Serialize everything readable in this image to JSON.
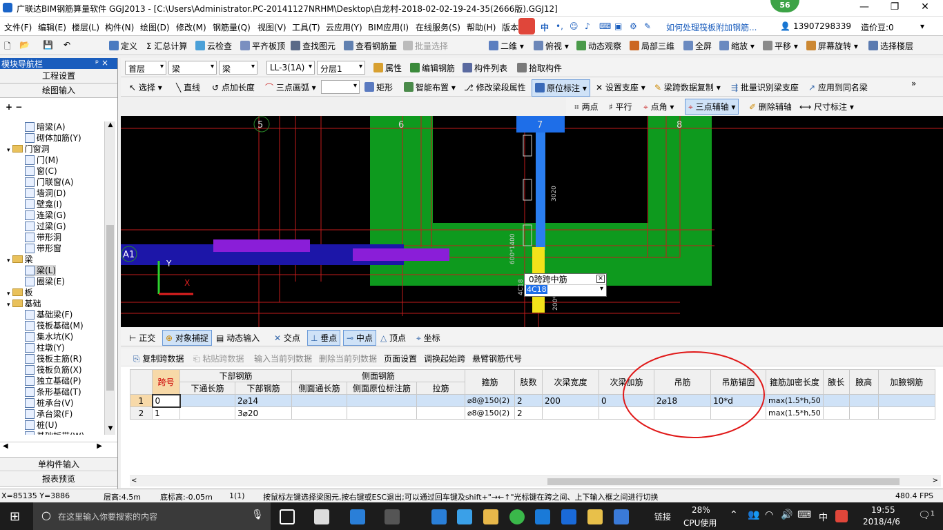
{
  "window": {
    "title": "广联达BIM钢筋算量软件 GGJ2013 - [C:\\Users\\Administrator.PC-20141127NRHM\\Desktop\\白龙村-2018-02-02-19-24-35(2666版).GGJ12]",
    "badge": "56",
    "minimize": "—",
    "restore": "❐",
    "close": "✕"
  },
  "menu": [
    "文件(F)",
    "编辑(E)",
    "楼层(L)",
    "构件(N)",
    "绘图(D)",
    "修改(M)",
    "钢筋量(Q)",
    "视图(V)",
    "工具(T)",
    "云应用(Y)",
    "BIM应用(I)",
    "在线服务(S)",
    "帮助(H)",
    "版本"
  ],
  "menu_right": {
    "ime": "中",
    "link": "如何处理筏板附加钢筋...",
    "phone": "13907298339",
    "price": "造价豆:0"
  },
  "toolbar1": [
    "定义",
    "Σ 汇总计算",
    "云检查",
    "平齐板顶",
    "查找图元",
    "查看钢筋量",
    "批量选择",
    "二维",
    "俯视",
    "动态观察",
    "局部三维",
    "全屏",
    "缩放",
    "平移",
    "屏幕旋转",
    "选择楼层"
  ],
  "toolbar2": {
    "floor": "首层",
    "type1": "梁",
    "type2": "梁",
    "member": "LL-3(1A)",
    "layer": "分层1",
    "buttons": [
      "属性",
      "编辑钢筋",
      "构件列表",
      "拾取构件"
    ]
  },
  "toolbar3": [
    "选择",
    "直线",
    "点加长度",
    "三点画弧",
    "矩形",
    "智能布置",
    "修改梁段属性",
    "原位标注",
    "设置支座",
    "梁跨数据复制",
    "批量识别梁支座",
    "应用到同名梁"
  ],
  "toolbar4": [
    "两点",
    "平行",
    "点角",
    "三点辅轴",
    "删除辅轴",
    "尺寸标注"
  ],
  "leftpanel": {
    "title": "模块导航栏",
    "pin": "ᵖ ×",
    "btn1": "工程设置",
    "btn2": "绘图输入",
    "bottom1": "单构件输入",
    "bottom2": "报表预览",
    "tree": [
      {
        "label": "暗梁(A)",
        "level": 2
      },
      {
        "label": "砌体加筋(Y)",
        "level": 2
      },
      {
        "label": "门窗洞",
        "level": 1,
        "folder": true
      },
      {
        "label": "门(M)",
        "level": 2
      },
      {
        "label": "窗(C)",
        "level": 2
      },
      {
        "label": "门联窗(A)",
        "level": 2
      },
      {
        "label": "墙洞(D)",
        "level": 2
      },
      {
        "label": "壁龛(I)",
        "level": 2
      },
      {
        "label": "连梁(G)",
        "level": 2
      },
      {
        "label": "过梁(G)",
        "level": 2
      },
      {
        "label": "带形洞",
        "level": 2
      },
      {
        "label": "带形窗",
        "level": 2
      },
      {
        "label": "梁",
        "level": 1,
        "folder": true
      },
      {
        "label": "梁(L)",
        "level": 2,
        "selected": true
      },
      {
        "label": "圈梁(E)",
        "level": 2
      },
      {
        "label": "板",
        "level": 1,
        "folder": true
      },
      {
        "label": "基础",
        "level": 1,
        "folder": true
      },
      {
        "label": "基础梁(F)",
        "level": 2
      },
      {
        "label": "筏板基础(M)",
        "level": 2
      },
      {
        "label": "集水坑(K)",
        "level": 2
      },
      {
        "label": "柱墩(Y)",
        "level": 2
      },
      {
        "label": "筏板主筋(R)",
        "level": 2
      },
      {
        "label": "筏板负筋(X)",
        "level": 2
      },
      {
        "label": "独立基础(P)",
        "level": 2
      },
      {
        "label": "条形基础(T)",
        "level": 2
      },
      {
        "label": "桩承台(V)",
        "level": 2
      },
      {
        "label": "承台梁(F)",
        "level": 2
      },
      {
        "label": "桩(U)",
        "level": 2
      },
      {
        "label": "基础板带(W)",
        "level": 2
      }
    ]
  },
  "canvas": {
    "axis_labels": [
      "5",
      "6",
      "7",
      "8",
      "A1"
    ],
    "dim_texts": [
      "3020",
      "600*1400",
      "4C18",
      "200*400"
    ],
    "popup_title": "0跨跨中筋",
    "popup_value": "4C18",
    "popup_close": "✕",
    "y_label": "Y",
    "x_label": "X"
  },
  "bottomtoolbar": [
    "正交",
    "对象捕捉",
    "动态输入",
    "交点",
    "垂点",
    "中点",
    "顶点",
    "坐标"
  ],
  "tabletoolbar": [
    "复制跨数据",
    "粘贴跨数据",
    "输入当前列数据",
    "删除当前列数据",
    "页面设置",
    "调换起始跨",
    "悬臂钢筋代号"
  ],
  "table": {
    "top_headers": [
      "跨号",
      "下部钢筋",
      "侧面钢筋",
      "箍筋",
      "肢数",
      "次梁宽度",
      "次梁加筋",
      "吊筋",
      "吊筋锚固",
      "箍筋加密长度",
      "腋长",
      "腋高",
      "加腋钢筋"
    ],
    "sub_headers": [
      "下通长筋",
      "下部钢筋",
      "侧面通长筋",
      "侧面原位标注筋",
      "拉筋"
    ],
    "rows": [
      {
        "idx": "1",
        "span": "0",
        "bottom_through": "",
        "bottom": "2⌀14",
        "side_through": "",
        "side_mark": "",
        "tie": "",
        "stirrup": "⌀8@150(2)",
        "legs": "2",
        "secondary_width": "200",
        "secondary_add": "0",
        "hanger": "2⌀18",
        "hanger_anchor": "10*d",
        "dense_len": "max(1.5*h,50",
        "haunch_len": "",
        "haunch_h": "",
        "haunch_bar": ""
      },
      {
        "idx": "2",
        "span": "1",
        "bottom_through": "",
        "bottom": "3⌀20",
        "side_through": "",
        "side_mark": "",
        "tie": "",
        "stirrup": "⌀8@150(2)",
        "legs": "2",
        "secondary_width": "",
        "secondary_add": "",
        "hanger": "",
        "hanger_anchor": "",
        "dense_len": "max(1.5*h,50",
        "haunch_len": "",
        "haunch_h": "",
        "haunch_bar": ""
      }
    ]
  },
  "status": {
    "coords": "X=85135 Y=3886",
    "floor_h": "层高:4.5m",
    "base_h": "底标高:-0.05m",
    "count": "1(1)",
    "hint": "按鼠标左键选择梁图元,按右键或ESC退出;可以通过回车键及shift+\"→←↑\"光标键在跨之间、上下输入框之间进行切换",
    "fps": "480.4 FPS"
  },
  "taskbar": {
    "search": "在这里输入你要搜索的内容",
    "link": "链接",
    "cpu": "28%",
    "cpu_label": "CPU使用",
    "ime": "中",
    "time": "19:55",
    "date": "2018/4/6",
    "notif": "1"
  }
}
